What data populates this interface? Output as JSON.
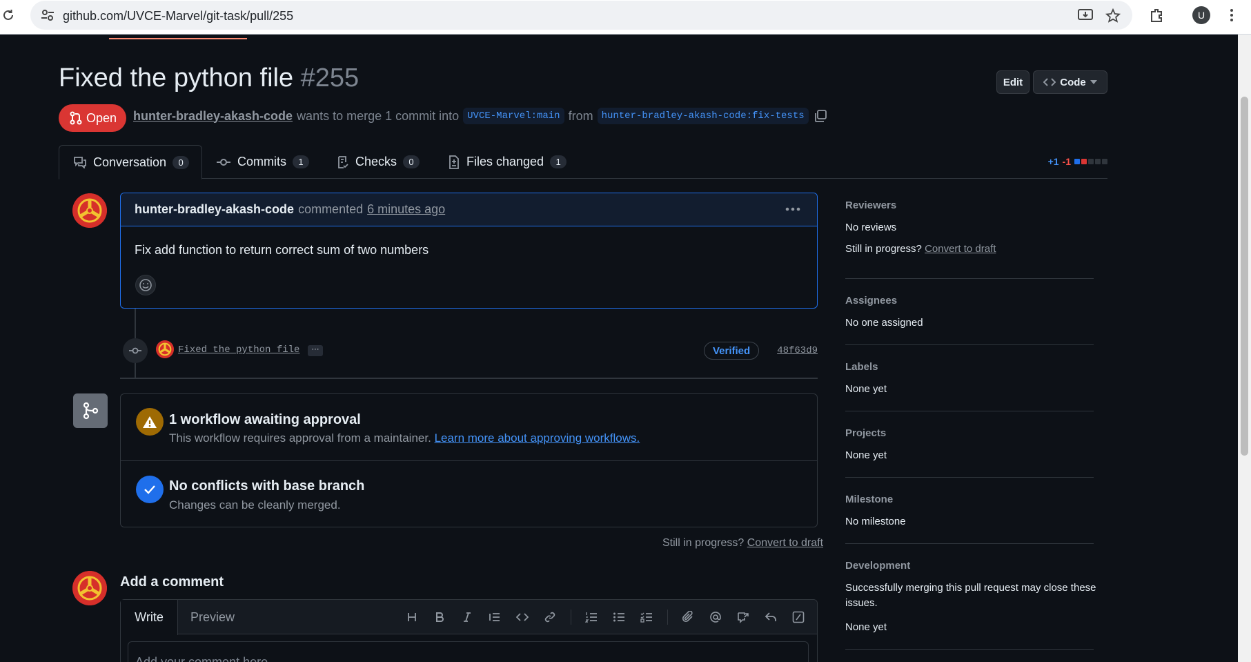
{
  "browser": {
    "url": "github.com/UVCE-Marvel/git-task/pull/255",
    "profile_initial": "U"
  },
  "header": {
    "title": "Fixed the python file",
    "number": "#255",
    "edit_label": "Edit",
    "code_label": "Code",
    "state": "Open",
    "author": "hunter-bradley-akash-code",
    "merge_text_1": "wants to merge 1 commit into",
    "base_branch": "UVCE-Marvel:main",
    "merge_text_2": "from",
    "head_branch": "hunter-bradley-akash-code:fix-tests"
  },
  "tabs": [
    {
      "label": "Conversation",
      "count": "0"
    },
    {
      "label": "Commits",
      "count": "1"
    },
    {
      "label": "Checks",
      "count": "0"
    },
    {
      "label": "Files changed",
      "count": "1"
    }
  ],
  "diffstat": {
    "additions": "+1",
    "deletions": "-1"
  },
  "comment": {
    "author": "hunter-bradley-akash-code",
    "action": "commented",
    "time": "6 minutes ago",
    "body": "Fix add function to return correct sum of two numbers"
  },
  "commit": {
    "message": "Fixed the python file",
    "ellipsis": "···",
    "verified": "Verified",
    "sha": "48f63d9"
  },
  "merge": {
    "workflow_title": "1 workflow awaiting approval",
    "workflow_sub": "This workflow requires approval from a maintainer.",
    "workflow_link": "Learn more about approving workflows.",
    "conflicts_title": "No conflicts with base branch",
    "conflicts_sub": "Changes can be cleanly merged."
  },
  "draft": {
    "prompt": "Still in progress?",
    "link": "Convert to draft"
  },
  "add_comment": {
    "title": "Add a comment",
    "write_tab": "Write",
    "preview_tab": "Preview",
    "placeholder": "Add your comment here..."
  },
  "sidebar": {
    "reviewers": {
      "title": "Reviewers",
      "value": "No reviews",
      "prompt": "Still in progress?",
      "link": "Convert to draft"
    },
    "assignees": {
      "title": "Assignees",
      "value": "No one assigned"
    },
    "labels": {
      "title": "Labels",
      "value": "None yet"
    },
    "projects": {
      "title": "Projects",
      "value": "None yet"
    },
    "milestone": {
      "title": "Milestone",
      "value": "No milestone"
    },
    "development": {
      "title": "Development",
      "line1": "Successfully merging this pull request may close these",
      "line2": "issues.",
      "value": "None yet"
    }
  },
  "colors": {
    "background": "#0d1117",
    "accent_blue": "#4493f8",
    "open_red": "#da3633",
    "warning": "#9e6a03",
    "success_blue": "#1f6feb"
  }
}
